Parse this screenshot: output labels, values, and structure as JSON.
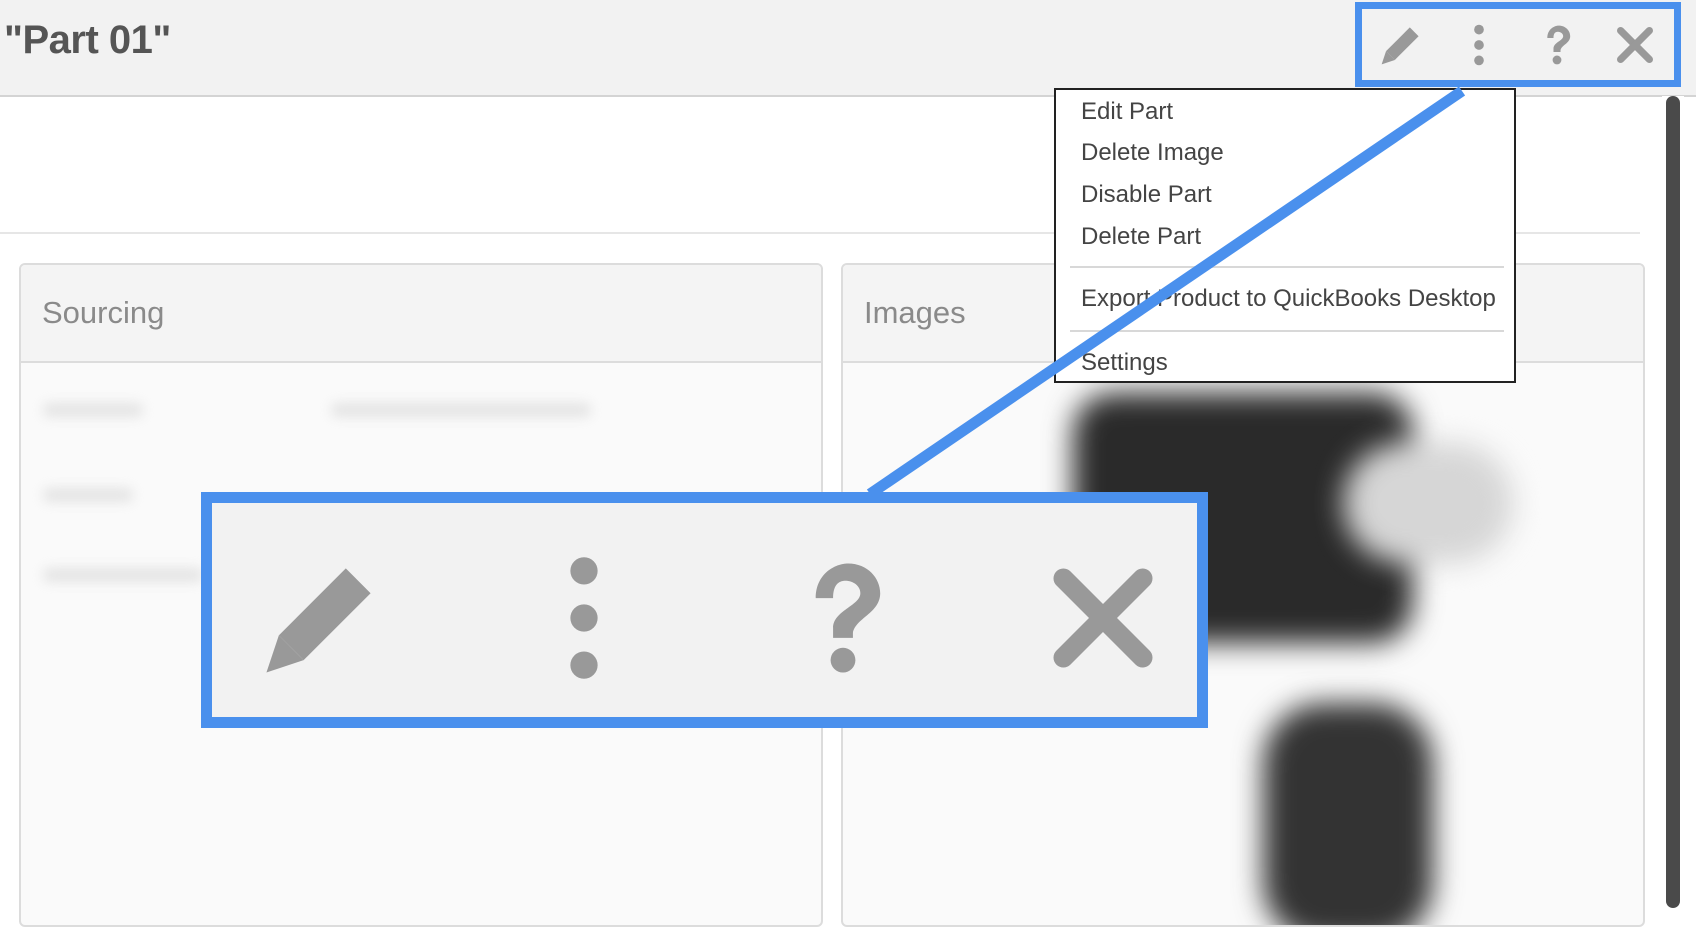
{
  "header": {
    "title": "\"Part 01\"",
    "toolbar": {
      "edit_icon": "pencil-icon",
      "more_icon": "vertical-dots-icon",
      "help_icon": "question-icon",
      "close_icon": "close-x-icon"
    }
  },
  "panels": {
    "sourcing": {
      "title": "Sourcing"
    },
    "images": {
      "title": "Images"
    }
  },
  "menu": {
    "items": [
      {
        "label": "Edit Part"
      },
      {
        "label": "Delete Image"
      },
      {
        "label": "Disable Part"
      },
      {
        "label": "Delete Part"
      },
      {
        "label": "Export Product to QuickBooks Desktop"
      },
      {
        "label": "Settings"
      }
    ]
  },
  "colors": {
    "highlight": "#4a90ed",
    "icon": "#999999",
    "header_bg": "#f2f2f2",
    "title": "#555555"
  }
}
